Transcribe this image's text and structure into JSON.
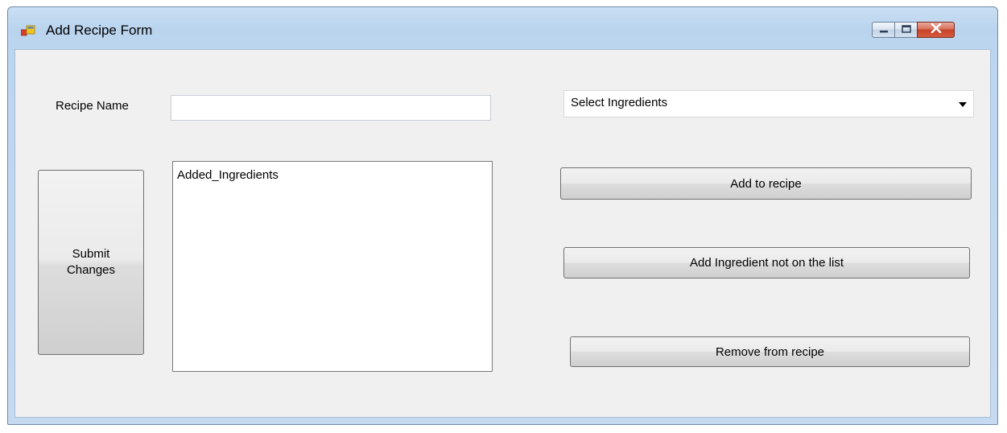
{
  "window": {
    "title": "Add Recipe Form",
    "controls": {
      "minimize": "minimize-icon",
      "maximize": "maximize-icon",
      "close": "close-icon"
    },
    "accent": "#c7412a"
  },
  "form": {
    "recipe_name_label": "Recipe Name",
    "recipe_name_value": "",
    "ingredients_dropdown": {
      "selected": "Select Ingredients"
    },
    "added_ingredients_list": {
      "items": [
        "Added_Ingredients"
      ]
    },
    "buttons": {
      "submit_line1": "Submit",
      "submit_line2": "Changes",
      "add_to_recipe": "Add to recipe",
      "add_not_on_list": "Add Ingredient not on the list",
      "remove_from_recipe": "Remove from recipe"
    }
  }
}
